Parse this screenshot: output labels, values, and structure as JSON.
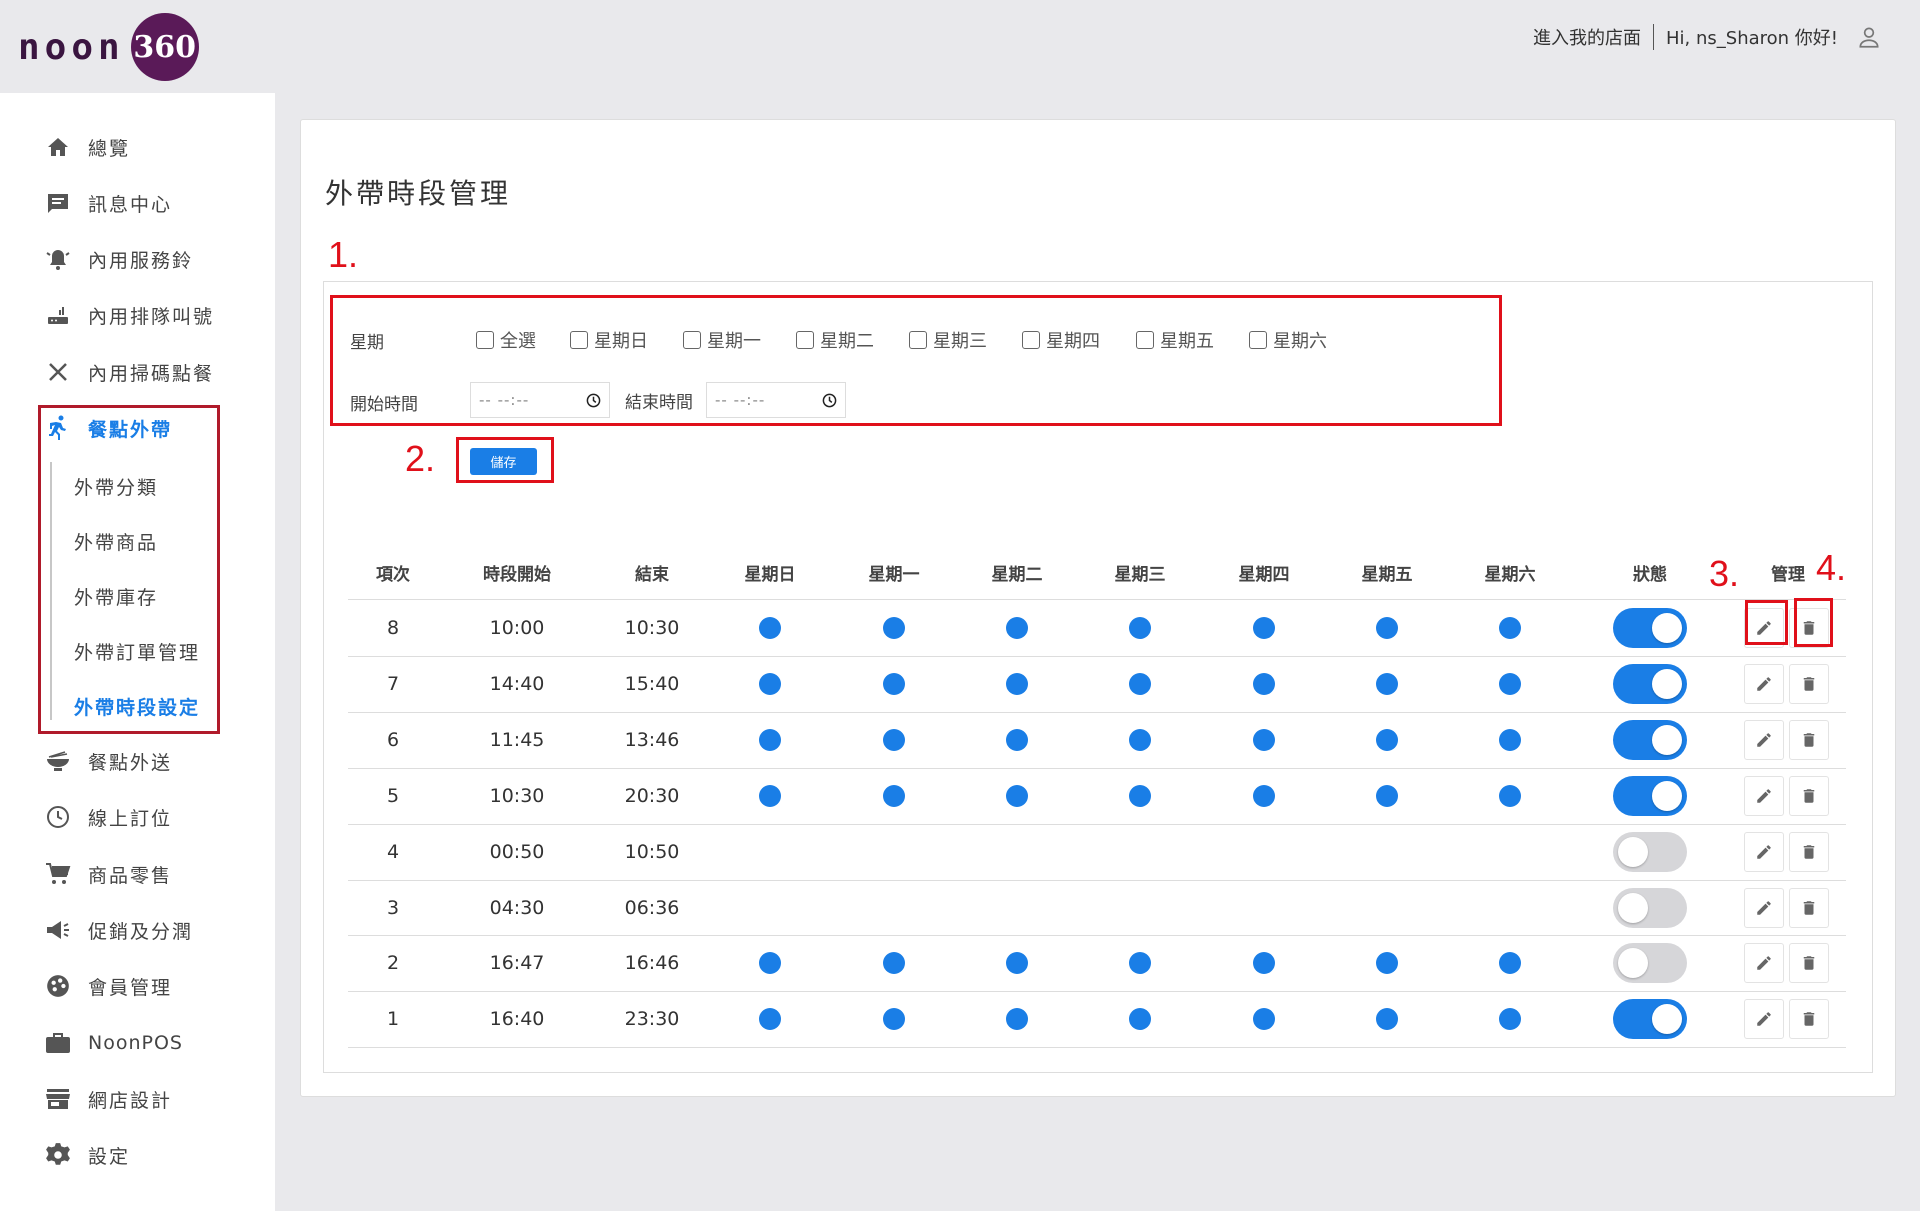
{
  "header": {
    "logo_text": "noon",
    "logo_badge": "360",
    "store_link": "進入我的店面",
    "greeting": "Hi, ns_Sharon 你好!"
  },
  "sidebar": {
    "items": [
      {
        "label": "總覽",
        "icon": "home-icon"
      },
      {
        "label": "訊息中心",
        "icon": "message-icon"
      },
      {
        "label": "內用服務鈴",
        "icon": "bell-icon"
      },
      {
        "label": "內用排隊叫號",
        "icon": "router-icon"
      },
      {
        "label": "內用掃碼點餐",
        "icon": "utensils-icon"
      },
      {
        "label": "餐點外帶",
        "icon": "runner-icon"
      },
      {
        "label": "餐點外送",
        "icon": "bowl-icon"
      },
      {
        "label": "線上訂位",
        "icon": "clock-icon"
      },
      {
        "label": "商品零售",
        "icon": "cart-icon"
      },
      {
        "label": "促銷及分潤",
        "icon": "megaphone-icon"
      },
      {
        "label": "會員管理",
        "icon": "palette-icon"
      },
      {
        "label": "NoonPOS",
        "icon": "briefcase-icon"
      },
      {
        "label": "網店設計",
        "icon": "store-icon"
      },
      {
        "label": "設定",
        "icon": "gear-icon"
      }
    ],
    "subitems": [
      {
        "label": "外帶分類"
      },
      {
        "label": "外帶商品"
      },
      {
        "label": "外帶庫存"
      },
      {
        "label": "外帶訂單管理"
      },
      {
        "label": "外帶時段設定"
      }
    ]
  },
  "page": {
    "title": "外帶時段管理"
  },
  "annotations": [
    "1.",
    "2.",
    "3.",
    "4."
  ],
  "form": {
    "weekday_label": "星期",
    "checkboxes": [
      "全選",
      "星期日",
      "星期一",
      "星期二",
      "星期三",
      "星期四",
      "星期五",
      "星期六"
    ],
    "start_label": "開始時間",
    "end_label": "結束時間",
    "time_placeholder": "-- --:--",
    "save_label": "儲存"
  },
  "table": {
    "headers": [
      "項次",
      "時段開始",
      "結束",
      "星期日",
      "星期一",
      "星期二",
      "星期三",
      "星期四",
      "星期五",
      "星期六",
      "狀態",
      "管理"
    ],
    "rows": [
      {
        "id": "8",
        "start": "10:00",
        "end": "10:30",
        "days": [
          true,
          true,
          true,
          true,
          true,
          true,
          true
        ],
        "enabled": true
      },
      {
        "id": "7",
        "start": "14:40",
        "end": "15:40",
        "days": [
          true,
          true,
          true,
          true,
          true,
          true,
          true
        ],
        "enabled": true
      },
      {
        "id": "6",
        "start": "11:45",
        "end": "13:46",
        "days": [
          true,
          true,
          true,
          true,
          true,
          true,
          true
        ],
        "enabled": true
      },
      {
        "id": "5",
        "start": "10:30",
        "end": "20:30",
        "days": [
          true,
          true,
          true,
          true,
          true,
          true,
          true
        ],
        "enabled": true
      },
      {
        "id": "4",
        "start": "00:50",
        "end": "10:50",
        "days": [
          false,
          false,
          false,
          false,
          false,
          false,
          false
        ],
        "enabled": false
      },
      {
        "id": "3",
        "start": "04:30",
        "end": "06:36",
        "days": [
          false,
          false,
          false,
          false,
          false,
          false,
          false
        ],
        "enabled": false
      },
      {
        "id": "2",
        "start": "16:47",
        "end": "16:46",
        "days": [
          true,
          true,
          true,
          true,
          true,
          true,
          true
        ],
        "enabled": false
      },
      {
        "id": "1",
        "start": "16:40",
        "end": "23:30",
        "days": [
          true,
          true,
          true,
          true,
          true,
          true,
          true
        ],
        "enabled": true
      }
    ]
  },
  "colors": {
    "accent": "#1a7ee6",
    "annotation_red": "#e0101a",
    "toggle_off": "#d6d6d9"
  }
}
